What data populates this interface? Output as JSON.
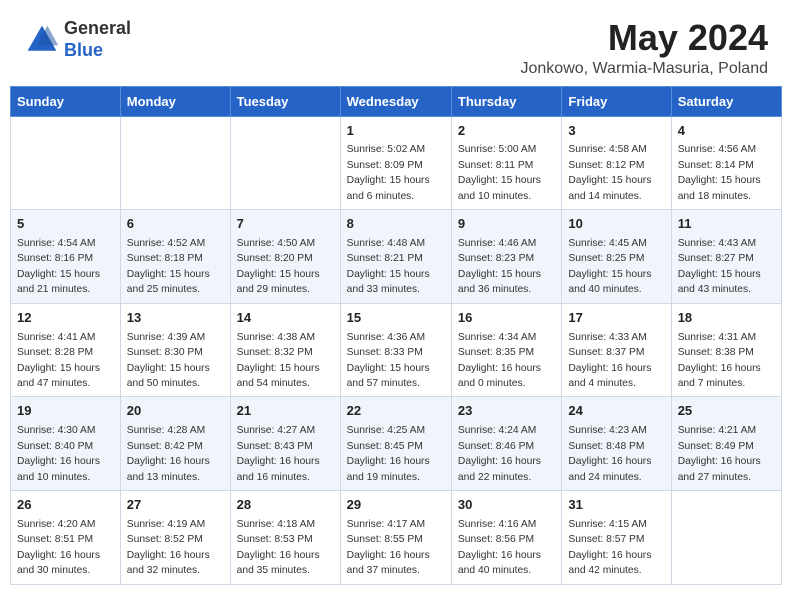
{
  "header": {
    "logo_general": "General",
    "logo_blue": "Blue",
    "month_title": "May 2024",
    "subtitle": "Jonkowo, Warmia-Masuria, Poland"
  },
  "days_of_week": [
    "Sunday",
    "Monday",
    "Tuesday",
    "Wednesday",
    "Thursday",
    "Friday",
    "Saturday"
  ],
  "weeks": [
    [
      {
        "day": "",
        "info": ""
      },
      {
        "day": "",
        "info": ""
      },
      {
        "day": "",
        "info": ""
      },
      {
        "day": "1",
        "info": "Sunrise: 5:02 AM\nSunset: 8:09 PM\nDaylight: 15 hours\nand 6 minutes."
      },
      {
        "day": "2",
        "info": "Sunrise: 5:00 AM\nSunset: 8:11 PM\nDaylight: 15 hours\nand 10 minutes."
      },
      {
        "day": "3",
        "info": "Sunrise: 4:58 AM\nSunset: 8:12 PM\nDaylight: 15 hours\nand 14 minutes."
      },
      {
        "day": "4",
        "info": "Sunrise: 4:56 AM\nSunset: 8:14 PM\nDaylight: 15 hours\nand 18 minutes."
      }
    ],
    [
      {
        "day": "5",
        "info": "Sunrise: 4:54 AM\nSunset: 8:16 PM\nDaylight: 15 hours\nand 21 minutes."
      },
      {
        "day": "6",
        "info": "Sunrise: 4:52 AM\nSunset: 8:18 PM\nDaylight: 15 hours\nand 25 minutes."
      },
      {
        "day": "7",
        "info": "Sunrise: 4:50 AM\nSunset: 8:20 PM\nDaylight: 15 hours\nand 29 minutes."
      },
      {
        "day": "8",
        "info": "Sunrise: 4:48 AM\nSunset: 8:21 PM\nDaylight: 15 hours\nand 33 minutes."
      },
      {
        "day": "9",
        "info": "Sunrise: 4:46 AM\nSunset: 8:23 PM\nDaylight: 15 hours\nand 36 minutes."
      },
      {
        "day": "10",
        "info": "Sunrise: 4:45 AM\nSunset: 8:25 PM\nDaylight: 15 hours\nand 40 minutes."
      },
      {
        "day": "11",
        "info": "Sunrise: 4:43 AM\nSunset: 8:27 PM\nDaylight: 15 hours\nand 43 minutes."
      }
    ],
    [
      {
        "day": "12",
        "info": "Sunrise: 4:41 AM\nSunset: 8:28 PM\nDaylight: 15 hours\nand 47 minutes."
      },
      {
        "day": "13",
        "info": "Sunrise: 4:39 AM\nSunset: 8:30 PM\nDaylight: 15 hours\nand 50 minutes."
      },
      {
        "day": "14",
        "info": "Sunrise: 4:38 AM\nSunset: 8:32 PM\nDaylight: 15 hours\nand 54 minutes."
      },
      {
        "day": "15",
        "info": "Sunrise: 4:36 AM\nSunset: 8:33 PM\nDaylight: 15 hours\nand 57 minutes."
      },
      {
        "day": "16",
        "info": "Sunrise: 4:34 AM\nSunset: 8:35 PM\nDaylight: 16 hours\nand 0 minutes."
      },
      {
        "day": "17",
        "info": "Sunrise: 4:33 AM\nSunset: 8:37 PM\nDaylight: 16 hours\nand 4 minutes."
      },
      {
        "day": "18",
        "info": "Sunrise: 4:31 AM\nSunset: 8:38 PM\nDaylight: 16 hours\nand 7 minutes."
      }
    ],
    [
      {
        "day": "19",
        "info": "Sunrise: 4:30 AM\nSunset: 8:40 PM\nDaylight: 16 hours\nand 10 minutes."
      },
      {
        "day": "20",
        "info": "Sunrise: 4:28 AM\nSunset: 8:42 PM\nDaylight: 16 hours\nand 13 minutes."
      },
      {
        "day": "21",
        "info": "Sunrise: 4:27 AM\nSunset: 8:43 PM\nDaylight: 16 hours\nand 16 minutes."
      },
      {
        "day": "22",
        "info": "Sunrise: 4:25 AM\nSunset: 8:45 PM\nDaylight: 16 hours\nand 19 minutes."
      },
      {
        "day": "23",
        "info": "Sunrise: 4:24 AM\nSunset: 8:46 PM\nDaylight: 16 hours\nand 22 minutes."
      },
      {
        "day": "24",
        "info": "Sunrise: 4:23 AM\nSunset: 8:48 PM\nDaylight: 16 hours\nand 24 minutes."
      },
      {
        "day": "25",
        "info": "Sunrise: 4:21 AM\nSunset: 8:49 PM\nDaylight: 16 hours\nand 27 minutes."
      }
    ],
    [
      {
        "day": "26",
        "info": "Sunrise: 4:20 AM\nSunset: 8:51 PM\nDaylight: 16 hours\nand 30 minutes."
      },
      {
        "day": "27",
        "info": "Sunrise: 4:19 AM\nSunset: 8:52 PM\nDaylight: 16 hours\nand 32 minutes."
      },
      {
        "day": "28",
        "info": "Sunrise: 4:18 AM\nSunset: 8:53 PM\nDaylight: 16 hours\nand 35 minutes."
      },
      {
        "day": "29",
        "info": "Sunrise: 4:17 AM\nSunset: 8:55 PM\nDaylight: 16 hours\nand 37 minutes."
      },
      {
        "day": "30",
        "info": "Sunrise: 4:16 AM\nSunset: 8:56 PM\nDaylight: 16 hours\nand 40 minutes."
      },
      {
        "day": "31",
        "info": "Sunrise: 4:15 AM\nSunset: 8:57 PM\nDaylight: 16 hours\nand 42 minutes."
      },
      {
        "day": "",
        "info": ""
      }
    ]
  ]
}
